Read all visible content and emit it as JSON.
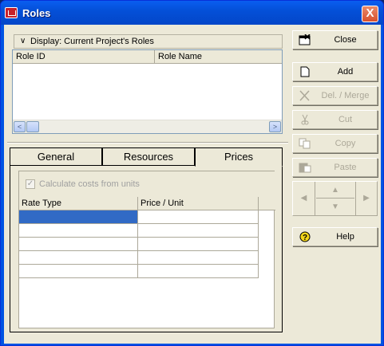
{
  "window": {
    "title": "Roles",
    "close_glyph": "X"
  },
  "display_bar": {
    "chevron": "∨",
    "label": "Display: Current Project's Roles"
  },
  "list": {
    "columns": [
      "Role ID",
      "Role Name"
    ],
    "scroll_left": "<",
    "scroll_right": ">"
  },
  "tabs": [
    {
      "label": "General"
    },
    {
      "label": "Resources"
    },
    {
      "label": "Prices",
      "active": true
    }
  ],
  "prices": {
    "calc_checkbox_label": "Calculate costs from units",
    "calc_checked": true,
    "checkbox_glyph": "✓",
    "grid_columns": [
      "Rate Type",
      "Price / Unit"
    ]
  },
  "buttons": {
    "close": {
      "label": "Close",
      "icon": "close-window-icon"
    },
    "add": {
      "label": "Add",
      "icon": "new-document-icon"
    },
    "del_merge": {
      "label": "Del. / Merge",
      "icon": "delete-x-icon"
    },
    "cut": {
      "label": "Cut",
      "icon": "scissors-icon"
    },
    "copy": {
      "label": "Copy",
      "icon": "copy-icon"
    },
    "paste": {
      "label": "Paste",
      "icon": "paste-icon"
    },
    "help": {
      "label": "Help",
      "icon": "help-icon",
      "glyph": "?"
    }
  },
  "nav_glyphs": {
    "left": "◀",
    "up": "▲",
    "down": "▼",
    "right": "▶"
  },
  "colors": {
    "title_bar": "#0450d8",
    "selection": "#316ac5",
    "face": "#ece9d8"
  }
}
